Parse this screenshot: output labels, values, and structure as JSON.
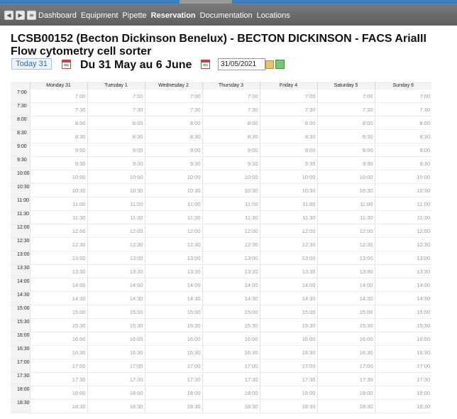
{
  "nav": {
    "icons": [
      "back-icon",
      "forward-icon",
      "menu-icon"
    ],
    "items": [
      "Dashboard",
      "Equipment",
      "Pipette",
      "Reservation",
      "Documentation",
      "Locations"
    ],
    "active": "Reservation"
  },
  "page": {
    "title": "LCSB00152 (Becton Dickinson Benelux) - BECTON DICKINSON - FACS AriaIII Flow cytometry cell sorter"
  },
  "controls": {
    "today_label": "Today 31",
    "week_label": "Du 31 May au 6 June",
    "date_value": "31/05/2021"
  },
  "calendar": {
    "days": [
      "Monday 31",
      "Tuesday 1",
      "Wednesday 2",
      "Thursday 3",
      "Friday 4",
      "Saturday 5",
      "Sunday 6"
    ],
    "times": [
      "7:00",
      "7:30",
      "8:00",
      "8:30",
      "9:00",
      "9:30",
      "10:00",
      "10:30",
      "11:00",
      "11:30",
      "12:00",
      "12:30",
      "13:00",
      "13:30",
      "14:00",
      "14:30",
      "15:00",
      "15:30",
      "16:00",
      "16:30",
      "17:00",
      "17:30",
      "18:00",
      "18:30"
    ]
  },
  "colors": {
    "accent_bar": "#3a7fc1",
    "today_text": "#2b6cb0",
    "calendar_icon": "#d33"
  }
}
